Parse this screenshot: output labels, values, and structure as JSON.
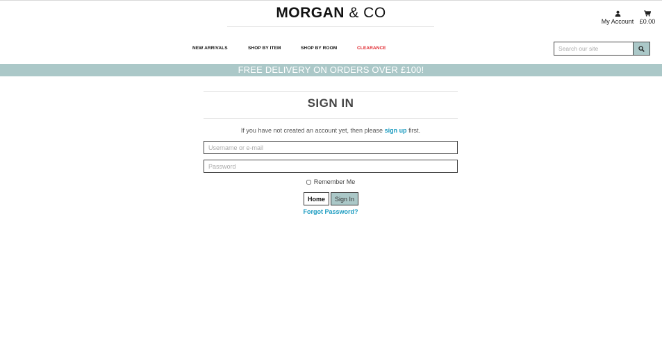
{
  "header": {
    "logo_bold": "MORGAN",
    "logo_light": "& CO",
    "account_label": "My Account",
    "cart_total": "£0.00"
  },
  "nav": {
    "items": [
      {
        "label": "NEW ARRIVALS"
      },
      {
        "label": "SHOP BY ITEM"
      },
      {
        "label": "SHOP BY ROOM"
      },
      {
        "label": "CLEARANCE"
      }
    ]
  },
  "search": {
    "placeholder": "Search our site",
    "value": ""
  },
  "banner": {
    "text": "FREE DELIVERY ON ORDERS OVER £100!"
  },
  "signin": {
    "title": "SIGN IN",
    "notice_before": "If you have not created an account yet, then please ",
    "notice_link": "sign up",
    "notice_after": " first.",
    "username_placeholder": "Username or e-mail",
    "username_value": "",
    "password_placeholder": "Password",
    "password_value": "",
    "remember_label": "Remember Me",
    "remember_checked": false,
    "home_button": "Home",
    "signin_button": "Sign In",
    "forgot_link": "Forgot Password?"
  },
  "colors": {
    "accent": "#abc8c8",
    "link": "#1a9bc0",
    "clearance": "#e0262d"
  },
  "icons": {
    "account": "user-icon",
    "cart": "shopping-cart-icon",
    "search": "magnifier-icon"
  }
}
